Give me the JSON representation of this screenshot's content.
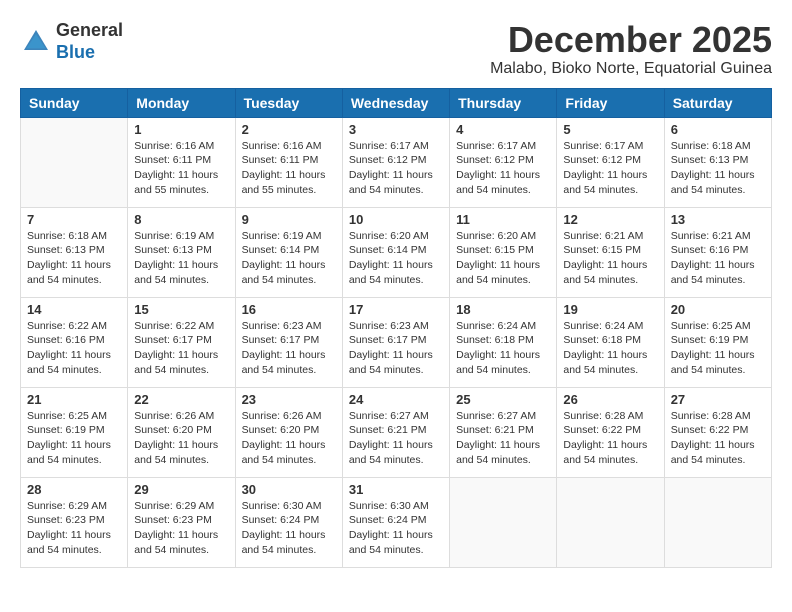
{
  "header": {
    "logo_general": "General",
    "logo_blue": "Blue",
    "month_year": "December 2025",
    "location": "Malabo, Bioko Norte, Equatorial Guinea"
  },
  "days_of_week": [
    "Sunday",
    "Monday",
    "Tuesday",
    "Wednesday",
    "Thursday",
    "Friday",
    "Saturday"
  ],
  "weeks": [
    [
      {
        "day": "",
        "info": ""
      },
      {
        "day": "1",
        "info": "Sunrise: 6:16 AM\nSunset: 6:11 PM\nDaylight: 11 hours\nand 55 minutes."
      },
      {
        "day": "2",
        "info": "Sunrise: 6:16 AM\nSunset: 6:11 PM\nDaylight: 11 hours\nand 55 minutes."
      },
      {
        "day": "3",
        "info": "Sunrise: 6:17 AM\nSunset: 6:12 PM\nDaylight: 11 hours\nand 54 minutes."
      },
      {
        "day": "4",
        "info": "Sunrise: 6:17 AM\nSunset: 6:12 PM\nDaylight: 11 hours\nand 54 minutes."
      },
      {
        "day": "5",
        "info": "Sunrise: 6:17 AM\nSunset: 6:12 PM\nDaylight: 11 hours\nand 54 minutes."
      },
      {
        "day": "6",
        "info": "Sunrise: 6:18 AM\nSunset: 6:13 PM\nDaylight: 11 hours\nand 54 minutes."
      }
    ],
    [
      {
        "day": "7",
        "info": "Sunrise: 6:18 AM\nSunset: 6:13 PM\nDaylight: 11 hours\nand 54 minutes."
      },
      {
        "day": "8",
        "info": "Sunrise: 6:19 AM\nSunset: 6:13 PM\nDaylight: 11 hours\nand 54 minutes."
      },
      {
        "day": "9",
        "info": "Sunrise: 6:19 AM\nSunset: 6:14 PM\nDaylight: 11 hours\nand 54 minutes."
      },
      {
        "day": "10",
        "info": "Sunrise: 6:20 AM\nSunset: 6:14 PM\nDaylight: 11 hours\nand 54 minutes."
      },
      {
        "day": "11",
        "info": "Sunrise: 6:20 AM\nSunset: 6:15 PM\nDaylight: 11 hours\nand 54 minutes."
      },
      {
        "day": "12",
        "info": "Sunrise: 6:21 AM\nSunset: 6:15 PM\nDaylight: 11 hours\nand 54 minutes."
      },
      {
        "day": "13",
        "info": "Sunrise: 6:21 AM\nSunset: 6:16 PM\nDaylight: 11 hours\nand 54 minutes."
      }
    ],
    [
      {
        "day": "14",
        "info": "Sunrise: 6:22 AM\nSunset: 6:16 PM\nDaylight: 11 hours\nand 54 minutes."
      },
      {
        "day": "15",
        "info": "Sunrise: 6:22 AM\nSunset: 6:17 PM\nDaylight: 11 hours\nand 54 minutes."
      },
      {
        "day": "16",
        "info": "Sunrise: 6:23 AM\nSunset: 6:17 PM\nDaylight: 11 hours\nand 54 minutes."
      },
      {
        "day": "17",
        "info": "Sunrise: 6:23 AM\nSunset: 6:17 PM\nDaylight: 11 hours\nand 54 minutes."
      },
      {
        "day": "18",
        "info": "Sunrise: 6:24 AM\nSunset: 6:18 PM\nDaylight: 11 hours\nand 54 minutes."
      },
      {
        "day": "19",
        "info": "Sunrise: 6:24 AM\nSunset: 6:18 PM\nDaylight: 11 hours\nand 54 minutes."
      },
      {
        "day": "20",
        "info": "Sunrise: 6:25 AM\nSunset: 6:19 PM\nDaylight: 11 hours\nand 54 minutes."
      }
    ],
    [
      {
        "day": "21",
        "info": "Sunrise: 6:25 AM\nSunset: 6:19 PM\nDaylight: 11 hours\nand 54 minutes."
      },
      {
        "day": "22",
        "info": "Sunrise: 6:26 AM\nSunset: 6:20 PM\nDaylight: 11 hours\nand 54 minutes."
      },
      {
        "day": "23",
        "info": "Sunrise: 6:26 AM\nSunset: 6:20 PM\nDaylight: 11 hours\nand 54 minutes."
      },
      {
        "day": "24",
        "info": "Sunrise: 6:27 AM\nSunset: 6:21 PM\nDaylight: 11 hours\nand 54 minutes."
      },
      {
        "day": "25",
        "info": "Sunrise: 6:27 AM\nSunset: 6:21 PM\nDaylight: 11 hours\nand 54 minutes."
      },
      {
        "day": "26",
        "info": "Sunrise: 6:28 AM\nSunset: 6:22 PM\nDaylight: 11 hours\nand 54 minutes."
      },
      {
        "day": "27",
        "info": "Sunrise: 6:28 AM\nSunset: 6:22 PM\nDaylight: 11 hours\nand 54 minutes."
      }
    ],
    [
      {
        "day": "28",
        "info": "Sunrise: 6:29 AM\nSunset: 6:23 PM\nDaylight: 11 hours\nand 54 minutes."
      },
      {
        "day": "29",
        "info": "Sunrise: 6:29 AM\nSunset: 6:23 PM\nDaylight: 11 hours\nand 54 minutes."
      },
      {
        "day": "30",
        "info": "Sunrise: 6:30 AM\nSunset: 6:24 PM\nDaylight: 11 hours\nand 54 minutes."
      },
      {
        "day": "31",
        "info": "Sunrise: 6:30 AM\nSunset: 6:24 PM\nDaylight: 11 hours\nand 54 minutes."
      },
      {
        "day": "",
        "info": ""
      },
      {
        "day": "",
        "info": ""
      },
      {
        "day": "",
        "info": ""
      }
    ]
  ]
}
